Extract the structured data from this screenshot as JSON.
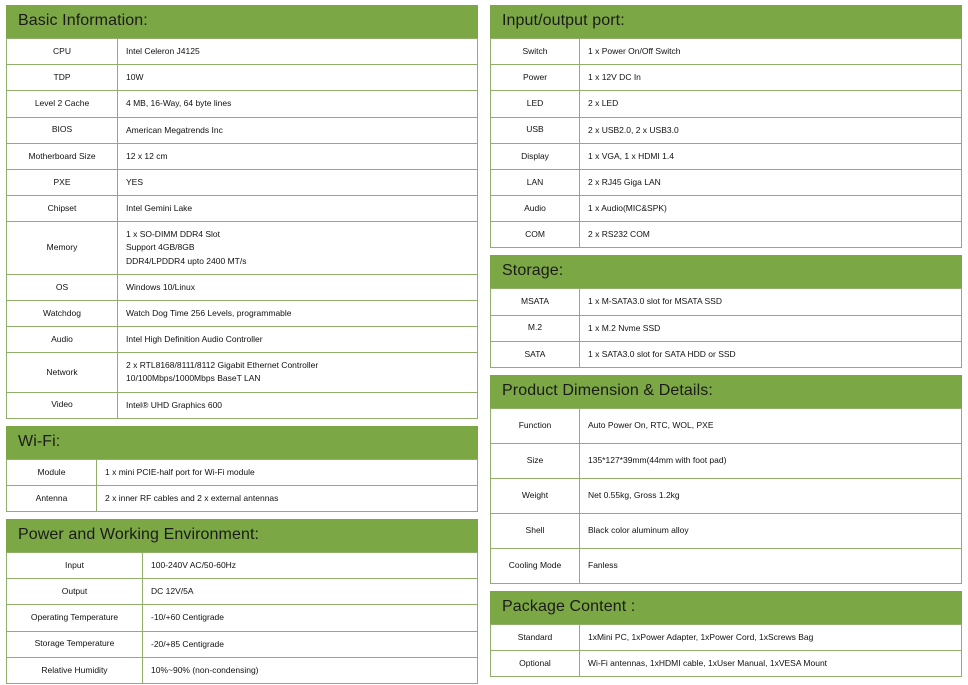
{
  "theme": {
    "header_green": "#7BA745",
    "border_green": "#8FAF6A",
    "text": "#111111",
    "background": "#FFFFFF"
  },
  "left_column": {
    "sections": [
      {
        "title": "Basic Information:",
        "rows": [
          {
            "label": "CPU",
            "lines": [
              "Intel Celeron J4125"
            ]
          },
          {
            "label": "TDP",
            "lines": [
              "10W"
            ]
          },
          {
            "label": "Level 2 Cache",
            "lines": [
              "4 MB, 16-Way, 64 byte lines"
            ]
          },
          {
            "label": "BIOS",
            "lines": [
              "American Megatrends Inc"
            ]
          },
          {
            "label": "Motherboard Size",
            "lines": [
              "12 x 12 cm"
            ]
          },
          {
            "label": "PXE",
            "lines": [
              "YES"
            ]
          },
          {
            "label": "Chipset",
            "lines": [
              "Intel Gemini Lake"
            ]
          },
          {
            "label": "Memory",
            "lines": [
              "1 x SO-DIMM DDR4 Slot",
              "Support 4GB/8GB",
              "DDR4/LPDDR4 upto 2400 MT/s"
            ]
          },
          {
            "label": "OS",
            "lines": [
              "Windows 10/Linux"
            ]
          },
          {
            "label": "Watchdog",
            "lines": [
              "Watch Dog Time 256 Levels, programmable"
            ]
          },
          {
            "label": "Audio",
            "lines": [
              "Intel High Definition Audio Controller"
            ]
          },
          {
            "label": "Network",
            "lines": [
              "2 x RTL8168/8111/8112 Gigabit Ethernet Controller",
              "10/100Mbps/1000Mbps BaseT LAN"
            ]
          },
          {
            "label": "Video",
            "lines": [
              "Intel® UHD Graphics 600"
            ]
          }
        ]
      },
      {
        "title": "Wi-Fi:",
        "rows": [
          {
            "label": "Module",
            "lines": [
              "1 x mini PCIE-half port for Wi-Fi module"
            ]
          },
          {
            "label": "Antenna",
            "lines": [
              "2 x inner RF cables and 2 x external antennas"
            ]
          }
        ]
      },
      {
        "title": "Power and Working Environment:",
        "rows": [
          {
            "label": "Input",
            "lines": [
              "100-240V AC/50-60Hz"
            ]
          },
          {
            "label": "Output",
            "lines": [
              "DC 12V/5A"
            ]
          },
          {
            "label": "Operating Temperature",
            "lines": [
              "-10/+60 Centigrade"
            ]
          },
          {
            "label": "Storage Temperature",
            "lines": [
              "-20/+85 Centigrade"
            ]
          },
          {
            "label": "Relative Humidity",
            "lines": [
              "10%~90% (non-condensing)"
            ]
          }
        ]
      }
    ]
  },
  "right_column": {
    "sections": [
      {
        "title": "Input/output port:",
        "rows": [
          {
            "label": "Switch",
            "lines": [
              "1 x Power On/Off Switch"
            ]
          },
          {
            "label": "Power",
            "lines": [
              "1 x 12V DC In"
            ]
          },
          {
            "label": "LED",
            "lines": [
              "2 x LED"
            ]
          },
          {
            "label": "USB",
            "lines": [
              "2 x USB2.0, 2 x USB3.0"
            ]
          },
          {
            "label": "Display",
            "lines": [
              "1 x VGA, 1 x HDMI 1.4"
            ]
          },
          {
            "label": "LAN",
            "lines": [
              "2 x RJ45 Giga LAN"
            ]
          },
          {
            "label": "Audio",
            "lines": [
              "1 x Audio(MIC&SPK)"
            ]
          },
          {
            "label": "COM",
            "lines": [
              "2 x RS232 COM"
            ]
          }
        ]
      },
      {
        "title": "Storage:",
        "rows": [
          {
            "label": "MSATA",
            "lines": [
              "1 x M-SATA3.0 slot for MSATA SSD"
            ]
          },
          {
            "label": "M.2",
            "lines": [
              "1 x M.2 Nvme SSD"
            ]
          },
          {
            "label": "SATA",
            "lines": [
              "1 x SATA3.0 slot for SATA HDD or SSD"
            ]
          }
        ]
      },
      {
        "title": "Product Dimension & Details:",
        "rows": [
          {
            "label": "Function",
            "lines": [
              "Auto Power On, RTC, WOL, PXE"
            ]
          },
          {
            "label": "Size",
            "lines": [
              "135*127*39mm(44mm with foot pad)"
            ]
          },
          {
            "label": "Weight",
            "lines": [
              "Net 0.55kg, Gross 1.2kg"
            ]
          },
          {
            "label": "Shell",
            "lines": [
              "Black color aluminum alloy"
            ]
          },
          {
            "label": "Cooling Mode",
            "lines": [
              "Fanless"
            ]
          }
        ]
      },
      {
        "title": "Package Content :",
        "rows": [
          {
            "label": "Standard",
            "lines": [
              "1xMini PC,  1xPower Adapter, 1xPower Cord, 1xScrews Bag"
            ]
          },
          {
            "label": "Optional",
            "lines": [
              "Wi-Fi antennas, 1xHDMI cable, 1xUser Manual, 1xVESA Mount"
            ]
          }
        ]
      }
    ]
  }
}
